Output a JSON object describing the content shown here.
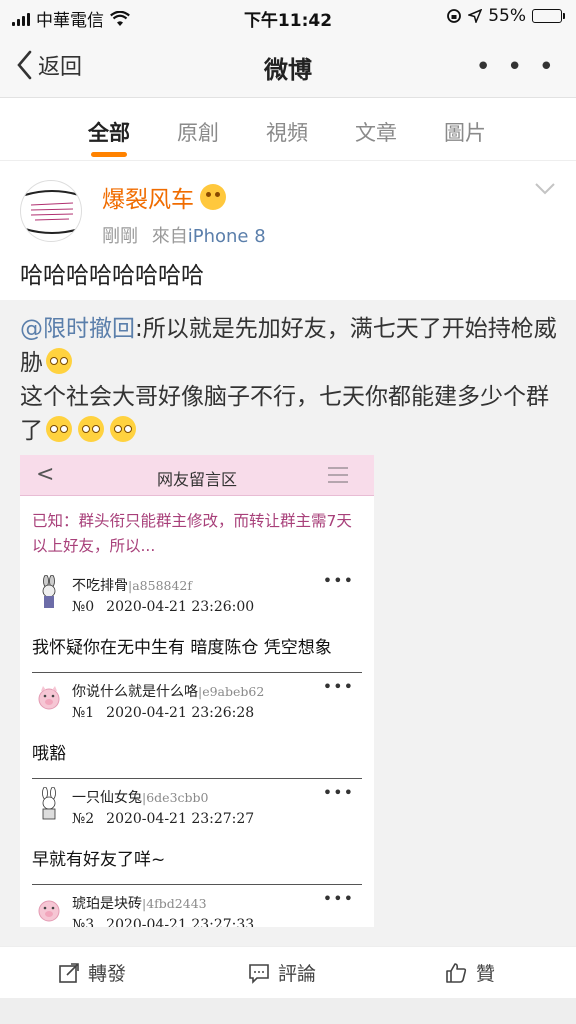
{
  "status_bar": {
    "carrier": "中華電信",
    "time": "下午11:42",
    "battery_percent": "55%",
    "battery_level": 0.55
  },
  "nav": {
    "back_label": "返回",
    "title": "微博",
    "more_label": "• • •"
  },
  "tabs": [
    {
      "label": "全部",
      "active": true
    },
    {
      "label": "原創",
      "active": false
    },
    {
      "label": "視頻",
      "active": false
    },
    {
      "label": "文章",
      "active": false
    },
    {
      "label": "圖片",
      "active": false
    }
  ],
  "post": {
    "author": "爆裂风车",
    "time": "剛剛",
    "source_prefix": "來自",
    "source": "iPhone 8",
    "text": "哈哈哈哈哈哈哈哈"
  },
  "repost": {
    "mention": "@限时撤回",
    "line1": ":所以就是先加好友，满七天了开始持枪威胁",
    "line2": "这个社会大哥好像脑子不行，七天你都能建多少个群了"
  },
  "screenshot": {
    "title": "网友留言区",
    "back": "<",
    "notice": "已知：群头衔只能群主修改，而转让群主需7天以上好友，所以...",
    "entries": [
      {
        "name": "不吃排骨",
        "hash": "|a858842f",
        "no": "№0",
        "timestamp": "2020-04-21 23:26:00",
        "body": "我怀疑你在无中生有 暗度陈仓 凭空想象",
        "dots": "•••"
      },
      {
        "name": "你说什么就是什么咯",
        "hash": "|e9abeb62",
        "no": "№1",
        "timestamp": "2020-04-21 23:26:28",
        "body": "哦豁",
        "dots": "•••"
      },
      {
        "name": "一只仙女兔",
        "hash": "|6de3cbb0",
        "no": "№2",
        "timestamp": "2020-04-21 23:27:27",
        "body": "早就有好友了咩~",
        "dots": "•••"
      },
      {
        "name": "琥珀是块砖",
        "hash": "|4fbd2443",
        "no": "№3",
        "timestamp": "2020-04-21 23:27:33",
        "body": "",
        "dots": "•••"
      }
    ]
  },
  "actions": {
    "repost": "轉發",
    "comment": "評論",
    "like": "贊"
  },
  "colors": {
    "accent": "#ff8200",
    "author": "#f06c00",
    "link": "#5b7fab",
    "notice": "#a8407a",
    "screenshot_header": "#f8dcea"
  }
}
